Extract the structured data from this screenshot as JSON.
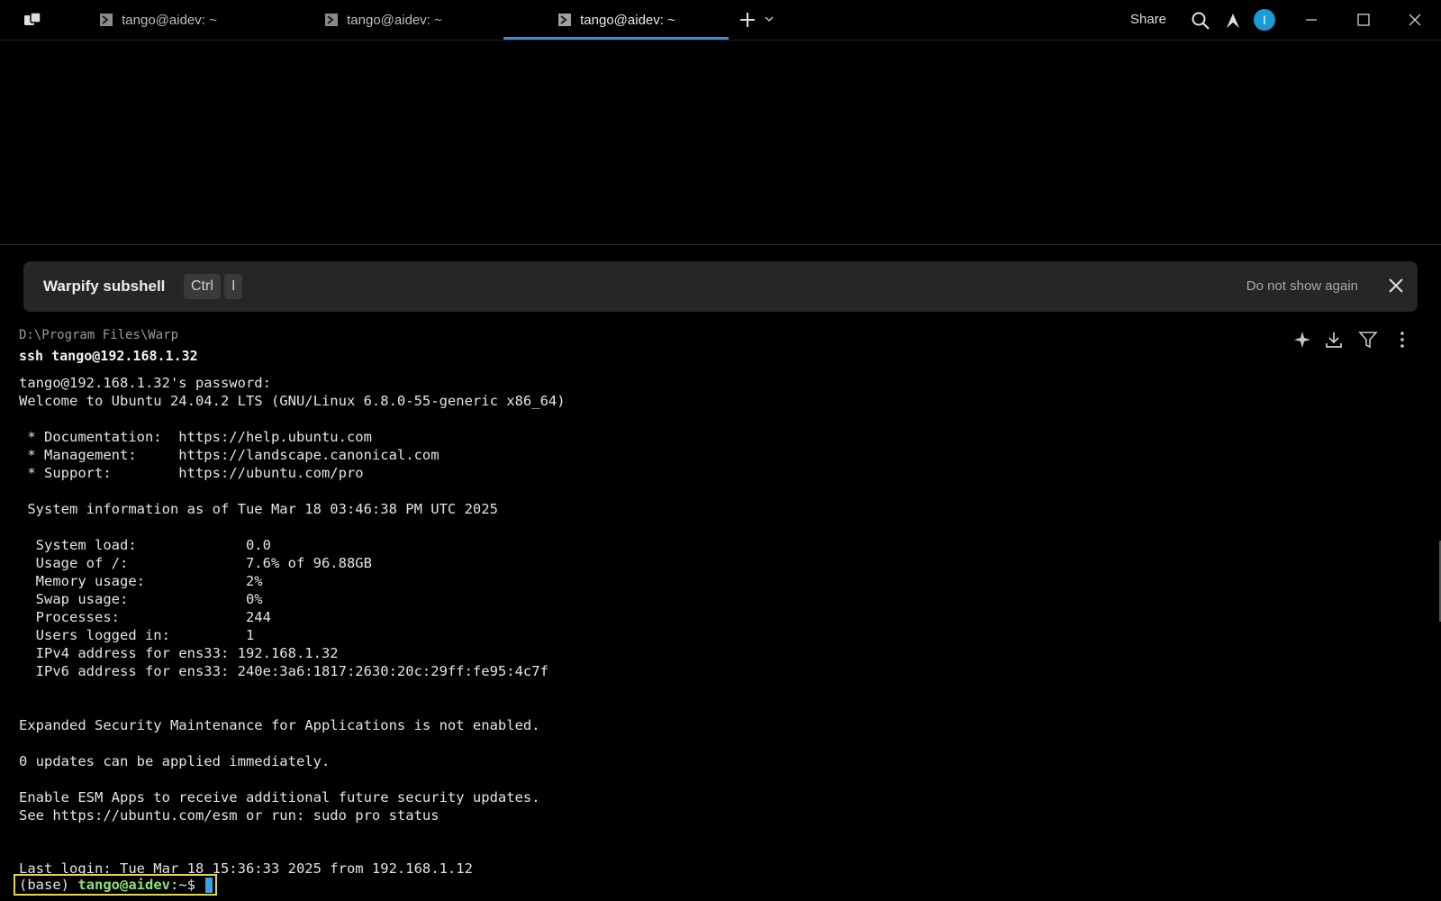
{
  "tabs": [
    {
      "label": "tango@aidev: ~",
      "active": false
    },
    {
      "label": "tango@aidev: ~",
      "active": false
    },
    {
      "label": "tango@aidev: ~",
      "active": true
    }
  ],
  "titlebar": {
    "share_label": "Share",
    "avatar_initial": "I",
    "icons": [
      "warp-logo-icon",
      "terminal-icon",
      "plus-icon",
      "chevron-down-icon",
      "search-icon",
      "warp-ai-icon",
      "minimize-icon",
      "maximize-icon",
      "close-icon"
    ]
  },
  "banner": {
    "title": "Warpify subshell",
    "key1": "Ctrl",
    "key2": "I",
    "dismiss_label": "Do not show again"
  },
  "block": {
    "cwd": "D:\\Program Files\\Warp",
    "command": "ssh tango@192.168.1.32",
    "tool_icons": [
      "sparkle-icon",
      "download-icon",
      "filter-icon",
      "kebab-menu-icon"
    ],
    "output": "tango@192.168.1.32's password:\nWelcome to Ubuntu 24.04.2 LTS (GNU/Linux 6.8.0-55-generic x86_64)\n\n * Documentation:  https://help.ubuntu.com\n * Management:     https://landscape.canonical.com\n * Support:        https://ubuntu.com/pro\n\n System information as of Tue Mar 18 03:46:38 PM UTC 2025\n\n  System load:             0.0\n  Usage of /:              7.6% of 96.88GB\n  Memory usage:            2%\n  Swap usage:              0%\n  Processes:               244\n  Users logged in:         1\n  IPv4 address for ens33: 192.168.1.32\n  IPv6 address for ens33: 240e:3a6:1817:2630:20c:29ff:fe95:4c7f\n\n\nExpanded Security Maintenance for Applications is not enabled.\n\n0 updates can be applied immediately.\n\nEnable ESM Apps to receive additional future security updates.\nSee https://ubuntu.com/esm or run: sudo pro status",
    "last_login": "Last login: Tue Mar 18 15:36:33 2025 from 192.168.1.12"
  },
  "prompt": {
    "env": "(base) ",
    "user_host": "tango@aidev",
    "suffix": ":~$"
  },
  "colors": {
    "accent": "#3a8fd8",
    "prompt_highlight": "#e3d64a",
    "prompt_user": "#8fe07a",
    "avatar": "#1b9ad6"
  }
}
